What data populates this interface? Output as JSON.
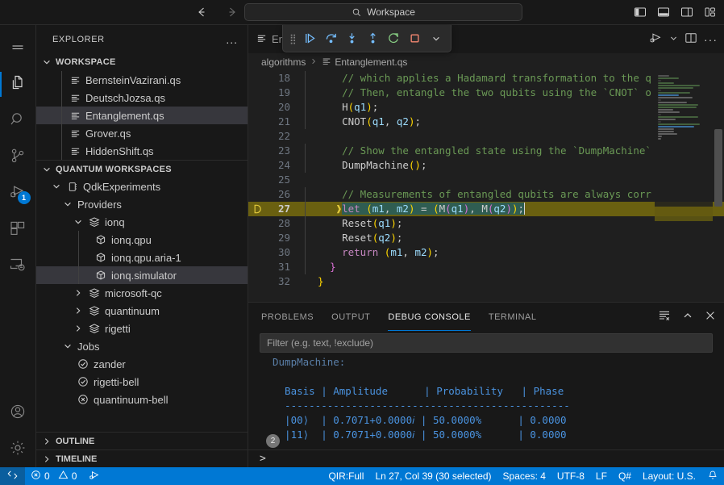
{
  "titlebar": {
    "back_icon": "arrow-left-icon",
    "forward_icon": "arrow-right-icon",
    "search": {
      "placeholder": "Workspace",
      "value": "Workspace",
      "icon": "search-icon"
    },
    "layout_buttons": [
      {
        "name": "toggle-primary-sidebar",
        "label": "Toggle Primary Side Bar"
      },
      {
        "name": "toggle-panel",
        "label": "Toggle Panel"
      },
      {
        "name": "toggle-secondary-sidebar",
        "label": "Toggle Secondary Side Bar"
      },
      {
        "name": "customize-layout",
        "label": "Customize Layout"
      }
    ]
  },
  "activitybar": {
    "items": [
      {
        "name": "menu",
        "icon": "hamburger-menu-icon",
        "label": "Menu",
        "active": false,
        "badge": ""
      },
      {
        "name": "explorer",
        "icon": "files-icon",
        "label": "Explorer",
        "active": true,
        "badge": ""
      },
      {
        "name": "search",
        "icon": "search-icon",
        "label": "Search",
        "active": false,
        "badge": ""
      },
      {
        "name": "source-control",
        "icon": "source-control-icon",
        "label": "Source Control",
        "active": false,
        "badge": ""
      },
      {
        "name": "run-and-debug",
        "icon": "run-debug-icon",
        "label": "Run and Debug",
        "active": false,
        "badge": "1"
      },
      {
        "name": "extensions",
        "icon": "extensions-icon",
        "label": "Extensions",
        "active": false,
        "badge": ""
      },
      {
        "name": "remote-explorer",
        "icon": "remote-explorer-icon",
        "label": "Remote Explorer",
        "active": false,
        "badge": ""
      }
    ],
    "bottom": [
      {
        "name": "accounts",
        "icon": "account-icon",
        "label": "Accounts"
      },
      {
        "name": "settings",
        "icon": "gear-icon",
        "label": "Manage"
      }
    ]
  },
  "sidebar": {
    "title": "EXPLORER",
    "more_label": "...",
    "sections": [
      {
        "name": "workspace",
        "label": "WORKSPACE",
        "expanded": true,
        "items": [
          {
            "label": "BernsteinVazirani.qs",
            "icon": "qsharp-file-icon",
            "indent": 2,
            "selected": false
          },
          {
            "label": "DeutschJozsa.qs",
            "icon": "qsharp-file-icon",
            "indent": 2,
            "selected": false
          },
          {
            "label": "Entanglement.qs",
            "icon": "qsharp-file-icon",
            "indent": 2,
            "selected": true
          },
          {
            "label": "Grover.qs",
            "icon": "qsharp-file-icon",
            "indent": 2,
            "selected": false
          },
          {
            "label": "HiddenShift.qs",
            "icon": "qsharp-file-icon",
            "indent": 2,
            "selected": false
          }
        ]
      },
      {
        "name": "quantum-workspaces",
        "label": "QUANTUM WORKSPACES",
        "expanded": true,
        "items": [
          {
            "label": "QdkExperiments",
            "icon": "workspace-icon",
            "indent": 1,
            "twisty": "expanded",
            "selected": false
          },
          {
            "label": "Providers",
            "icon": "none",
            "indent": 2,
            "twisty": "expanded",
            "selected": false
          },
          {
            "label": "ionq",
            "icon": "layers-icon",
            "indent": 3,
            "twisty": "expanded",
            "selected": false
          },
          {
            "label": "ionq.qpu",
            "icon": "cube-icon",
            "indent": 4,
            "twisty": "none",
            "selected": false
          },
          {
            "label": "ionq.qpu.aria-1",
            "icon": "cube-icon",
            "indent": 4,
            "twisty": "none",
            "selected": false
          },
          {
            "label": "ionq.simulator",
            "icon": "cube-icon",
            "indent": 4,
            "twisty": "none",
            "selected": true
          },
          {
            "label": "microsoft-qc",
            "icon": "layers-icon",
            "indent": 3,
            "twisty": "collapsed",
            "selected": false
          },
          {
            "label": "quantinuum",
            "icon": "layers-icon",
            "indent": 3,
            "twisty": "collapsed",
            "selected": false
          },
          {
            "label": "rigetti",
            "icon": "layers-icon",
            "indent": 3,
            "twisty": "collapsed",
            "selected": false
          },
          {
            "label": "Jobs",
            "icon": "none",
            "indent": 2,
            "twisty": "expanded",
            "selected": false
          },
          {
            "label": "zander",
            "icon": "check-circle-icon",
            "indent": 3,
            "twisty": "none",
            "selected": false
          },
          {
            "label": "rigetti-bell",
            "icon": "check-circle-icon",
            "indent": 3,
            "twisty": "none",
            "selected": false
          },
          {
            "label": "quantinuum-bell",
            "icon": "error-circle-icon",
            "indent": 3,
            "twisty": "none",
            "selected": false
          }
        ]
      }
    ],
    "collapsed_panes": [
      {
        "name": "outline",
        "label": "OUTLINE"
      },
      {
        "name": "timeline",
        "label": "TIMELINE"
      }
    ]
  },
  "editor": {
    "tab_label": "Entanglement.qs",
    "tab_icon": "qsharp-file-icon",
    "breadcrumbs": [
      {
        "label": "algorithms",
        "icon": "none"
      },
      {
        "label": "Entanglement.qs",
        "icon": "qsharp-file-icon"
      }
    ],
    "actions": [
      {
        "name": "run-or-debug",
        "icon": "run-debug-icon",
        "label": "Run or Debug..."
      },
      {
        "name": "split-editor",
        "icon": "split-editor-icon",
        "label": "Split Editor Right"
      },
      {
        "name": "more-actions",
        "icon": "ellipsis-icon",
        "label": "More Actions..."
      }
    ],
    "debug_toolbar": [
      {
        "name": "continue",
        "icon": "continue-icon",
        "label": "Continue",
        "color": "#75beff"
      },
      {
        "name": "step-over",
        "icon": "step-over-icon",
        "label": "Step Over",
        "color": "#75beff"
      },
      {
        "name": "step-into",
        "icon": "step-into-icon",
        "label": "Step Into",
        "color": "#75beff"
      },
      {
        "name": "step-out",
        "icon": "step-out-icon",
        "label": "Step Out",
        "color": "#75beff"
      },
      {
        "name": "restart",
        "icon": "restart-icon",
        "label": "Restart",
        "color": "#89d185"
      },
      {
        "name": "stop",
        "icon": "stop-icon",
        "label": "Stop",
        "color": "#f48771"
      },
      {
        "name": "debug-toolbar-dropdown",
        "icon": "chevron-down-icon",
        "label": "",
        "color": "#cccccc"
      }
    ],
    "current_line": 27,
    "lines": [
      {
        "no": "18",
        "text": "    // which applies a Hadamard transformation to the q",
        "kind": "comment"
      },
      {
        "no": "19",
        "text": "    // Then, entangle the two qubits using the `CNOT` o",
        "kind": "comment"
      },
      {
        "no": "20",
        "text": "    H(q1);",
        "kind": "call"
      },
      {
        "no": "21",
        "text": "    CNOT(q1, q2);",
        "kind": "call"
      },
      {
        "no": "22",
        "text": "",
        "kind": "blank"
      },
      {
        "no": "23",
        "text": "    // Show the entangled state using the `DumpMachine`",
        "kind": "comment"
      },
      {
        "no": "24",
        "text": "    DumpMachine();",
        "kind": "call"
      },
      {
        "no": "25",
        "text": "",
        "kind": "blank"
      },
      {
        "no": "26",
        "text": "    // Measurements of entangled qubits are always corr",
        "kind": "comment"
      },
      {
        "no": "27",
        "text": "    let (m1, m2) = (M(q1), M(q2));",
        "kind": "current"
      },
      {
        "no": "28",
        "text": "    Reset(q1);",
        "kind": "call"
      },
      {
        "no": "29",
        "text": "    Reset(q2);",
        "kind": "call"
      },
      {
        "no": "30",
        "text": "    return (m1, m2);",
        "kind": "return"
      },
      {
        "no": "31",
        "text": "  }",
        "kind": "brace"
      },
      {
        "no": "32",
        "text": "}",
        "kind": "brace"
      }
    ]
  },
  "panel": {
    "tabs": [
      {
        "name": "problems",
        "label": "PROBLEMS",
        "active": false
      },
      {
        "name": "output",
        "label": "OUTPUT",
        "active": false
      },
      {
        "name": "debug-console",
        "label": "DEBUG CONSOLE",
        "active": true
      },
      {
        "name": "terminal",
        "label": "TERMINAL",
        "active": false
      }
    ],
    "actions": [
      {
        "name": "clear-console",
        "icon": "clear-console-icon",
        "label": "Clear Console"
      },
      {
        "name": "maximize-panel",
        "icon": "chevron-up-icon",
        "label": "Maximize Panel Size"
      },
      {
        "name": "close-panel",
        "icon": "close-icon",
        "label": "Close Panel"
      }
    ],
    "filter": {
      "placeholder": "Filter (e.g. text, !exclude)",
      "value": ""
    },
    "console_lines": [
      {
        "text": "DumpMachine:",
        "style": "dim"
      },
      {
        "text": "",
        "style": "blue"
      },
      {
        "text": "  Basis | Amplitude      | Probability   | Phase",
        "style": "blue"
      },
      {
        "text": "  -----------------------------------------------",
        "style": "blue"
      },
      {
        "text": "  |00⟩  | 0.7071+0.0000𝑖 | 50.0000%      | 0.0000",
        "style": "blue"
      },
      {
        "text": "  |11⟩  | 0.7071+0.0000𝑖 | 50.0000%      | 0.0000",
        "style": "blue"
      }
    ],
    "repeat_badge": "2",
    "repl_prompt": ">"
  },
  "statusbar": {
    "left": [
      {
        "name": "remote-indicator",
        "icon": "remote-icon",
        "label": ""
      },
      {
        "name": "problems-errors",
        "icon": "error-icon",
        "label": "0"
      },
      {
        "name": "problems-warnings",
        "icon": "warning-icon",
        "label": "0"
      },
      {
        "name": "run-debug-status",
        "icon": "run-debug-icon",
        "label": ""
      }
    ],
    "right": [
      {
        "name": "qir-target",
        "label": "QIR:Full"
      },
      {
        "name": "editor-selection",
        "label": "Ln 27, Col 39 (30 selected)"
      },
      {
        "name": "indentation",
        "label": "Spaces: 4"
      },
      {
        "name": "encoding",
        "label": "UTF-8"
      },
      {
        "name": "eol",
        "label": "LF"
      },
      {
        "name": "language-mode",
        "label": "Q#"
      },
      {
        "name": "keyboard-layout",
        "label": "Layout: U.S."
      },
      {
        "name": "notifications",
        "icon": "bell-icon",
        "label": ""
      }
    ]
  },
  "colors": {
    "accent": "#0078d4",
    "statusbar_bg": "#0078d4",
    "editor_bg": "#1f1f1f",
    "sidebar_bg": "#181818",
    "current_line": "#6a6010",
    "selection": "#2f5d52",
    "comment": "#6a9955",
    "function": "#dcdcaa",
    "variable": "#9cdcfe",
    "keyword": "#c586c0"
  }
}
